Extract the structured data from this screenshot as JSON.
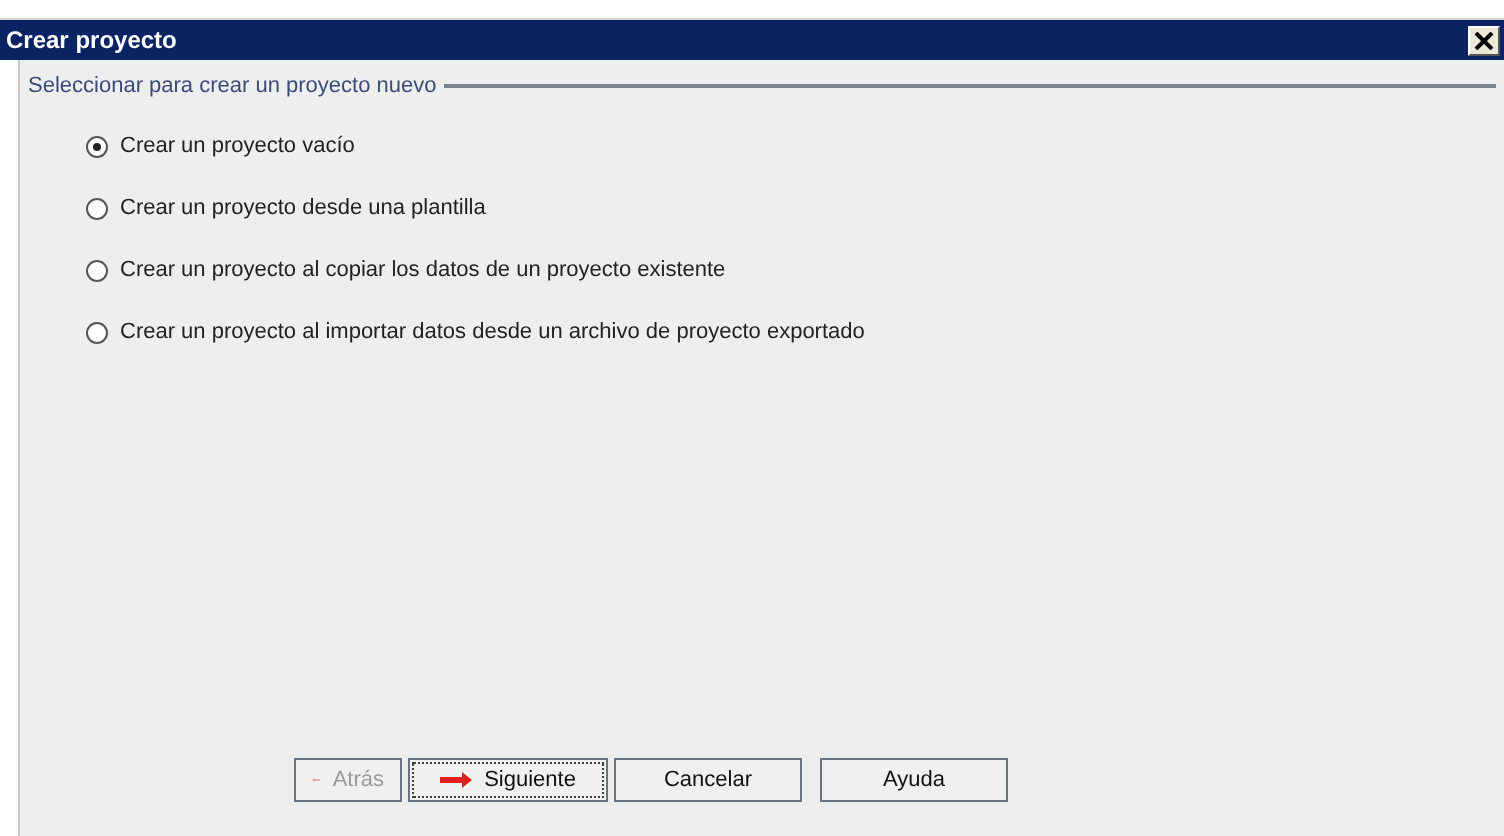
{
  "window": {
    "title": "Crear proyecto"
  },
  "group": {
    "label": "Seleccionar para crear un proyecto nuevo"
  },
  "options": [
    {
      "label": "Crear un proyecto vacío",
      "selected": true
    },
    {
      "label": "Crear un proyecto desde una plantilla",
      "selected": false
    },
    {
      "label": "Crear un proyecto al copiar los datos de un proyecto existente",
      "selected": false
    },
    {
      "label": "Crear un proyecto al importar datos desde un archivo de proyecto exportado",
      "selected": false
    }
  ],
  "buttons": [
    {
      "label": "Atrás",
      "kind": "back",
      "disabled": true,
      "focused": false
    },
    {
      "label": "Siguiente",
      "kind": "next",
      "disabled": false,
      "focused": true
    },
    {
      "label": "Cancelar",
      "kind": "plain",
      "disabled": false,
      "focused": false
    },
    {
      "label": "Ayuda",
      "kind": "plain",
      "disabled": false,
      "focused": false
    }
  ]
}
